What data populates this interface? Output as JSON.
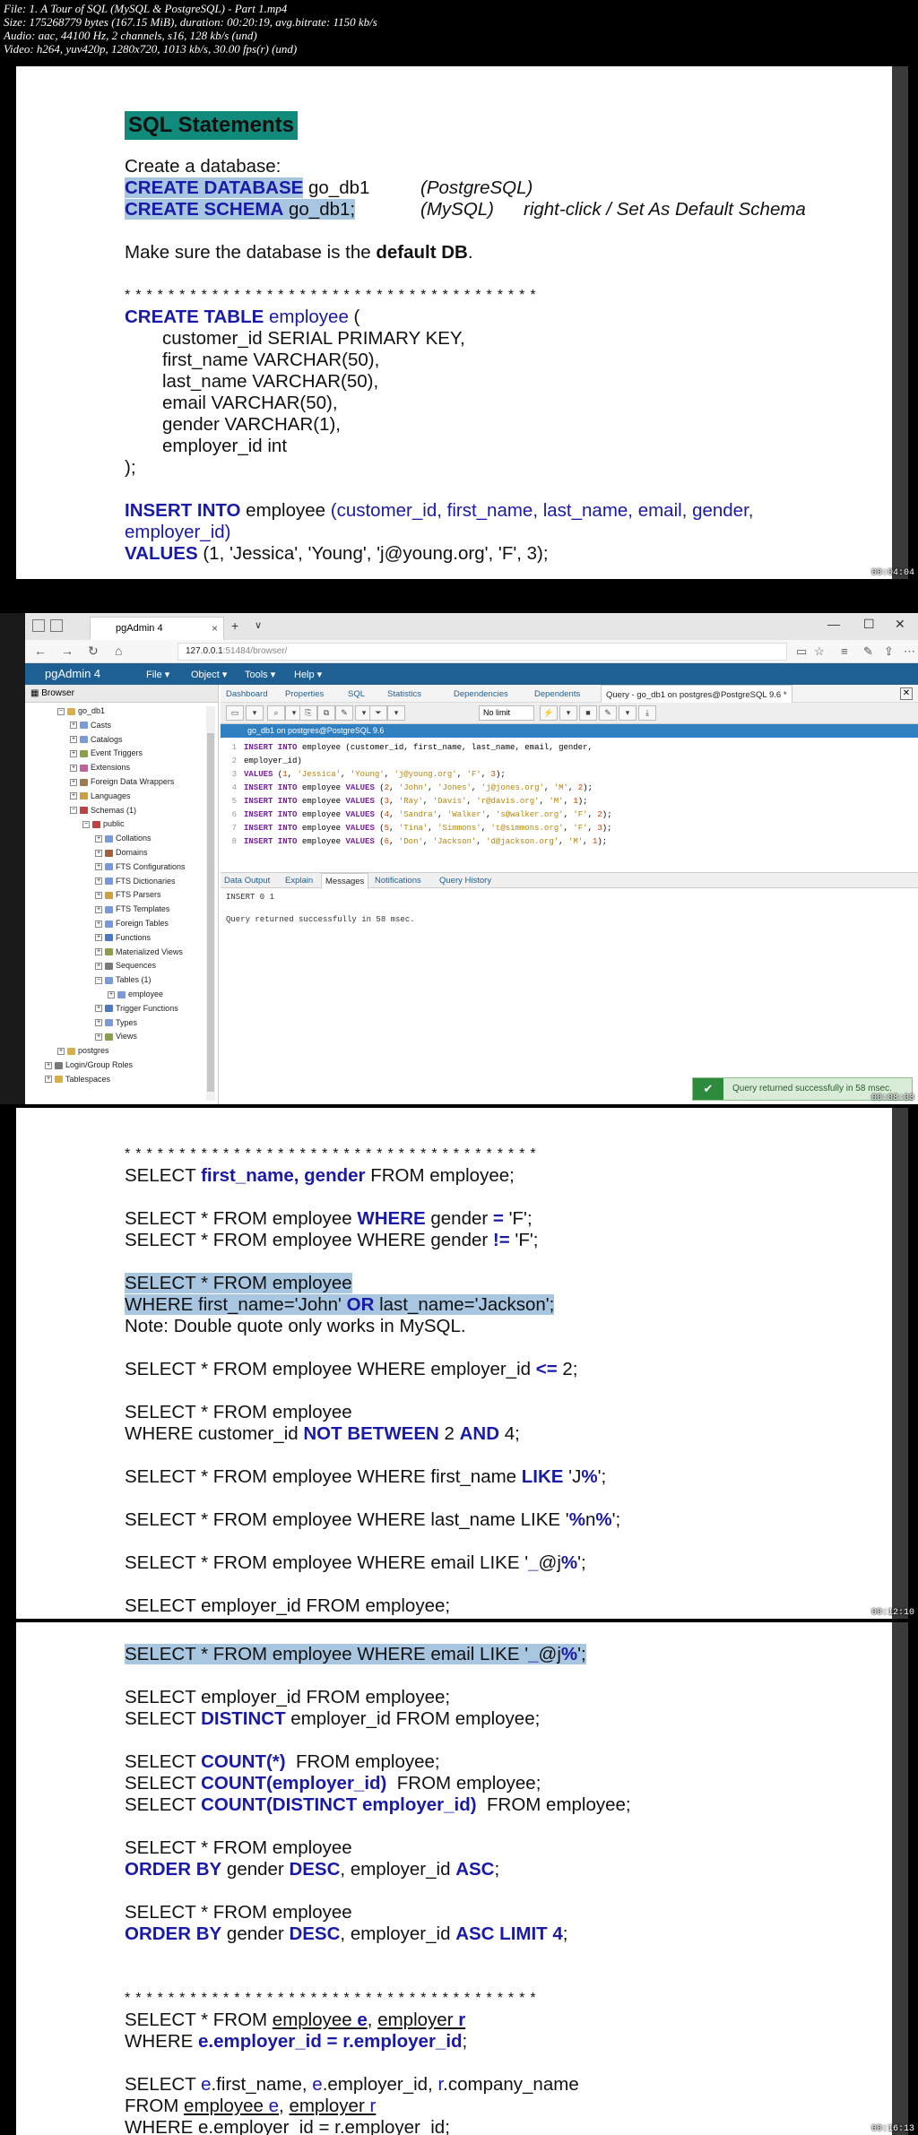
{
  "info": {
    "file": "File: 1. A Tour of SQL (MySQL & PostgreSQL) - Part 1.mp4",
    "size": "Size: 175268779 bytes (167.15 MiB), duration: 00:20:19, avg.bitrate: 1150 kb/s",
    "audio": "Audio: aac, 44100 Hz, 2 channels, s16, 128 kb/s (und)",
    "video": "Video: h264, yuv420p, 1280x720, 1013 kb/s, 30.00 fps(r) (und)"
  },
  "panel1": {
    "title": "SQL Statements",
    "create_db": "Create a database:",
    "create_database_kw": "CREATE DATABASE",
    "create_database_name": " go_db1",
    "postgres_note": "(PostgreSQL)",
    "create_schema_kw": "CREATE SCHEMA",
    "create_schema_name": " go_db1;",
    "mysql_note": "(MySQL)",
    "mysql_hint": "right-click / Set As Default Schema",
    "default_db_pre": "Make sure the database is the ",
    "default_db_bold": "default DB",
    "default_db_post": ".",
    "stars": "**************************************",
    "create_table_kw": "CREATE TABLE",
    "create_table_name": " employee",
    "create_table_paren": " (",
    "col1": "customer_id SERIAL PRIMARY KEY,",
    "col2": "first_name VARCHAR(50),",
    "col3": "last_name VARCHAR(50),",
    "col4": "email VARCHAR(50),",
    "col5": "gender VARCHAR(1),",
    "col6": "employer_id int",
    "close": ");",
    "insert_kw": "INSERT INTO",
    "insert_table": " employee ",
    "insert_cols": "(customer_id, first_name, last_name, email, gender,",
    "insert_cols2": "employer_id)",
    "values_kw": "VALUES",
    "values_data": " (1, 'Jessica', 'Young', 'j@young.org', 'F', 3);",
    "stamp": "00:04:04"
  },
  "pgadmin": {
    "tab_title": "pgAdmin 4",
    "tab_close": "×",
    "new_tab": "+",
    "tab_chevron": "∨",
    "win_min": "—",
    "win_max": "☐",
    "win_close": "✕",
    "nav_back": "←",
    "nav_forward": "→",
    "nav_refresh": "↻",
    "nav_home": "⌂",
    "url_host": "127.0.0.1",
    "url_path": ":51484/browser/",
    "brand": "pgAdmin 4",
    "menu": [
      "File ▾",
      "Object ▾",
      "Tools ▾",
      "Help ▾"
    ],
    "browser_label": "Browser",
    "tree": [
      {
        "label": "go_db1",
        "depth": 0,
        "sign": "−",
        "color": "#d8b04a"
      },
      {
        "label": "Casts",
        "depth": 1,
        "sign": "+",
        "color": "#7a9ad8"
      },
      {
        "label": "Catalogs",
        "depth": 1,
        "sign": "+",
        "color": "#7a9ad8"
      },
      {
        "label": "Event Triggers",
        "depth": 1,
        "sign": "+",
        "color": "#8aa04a"
      },
      {
        "label": "Extensions",
        "depth": 1,
        "sign": "+",
        "color": "#c060a0"
      },
      {
        "label": "Foreign Data Wrappers",
        "depth": 1,
        "sign": "+",
        "color": "#a07a4a"
      },
      {
        "label": "Languages",
        "depth": 1,
        "sign": "+",
        "color": "#d0a040"
      },
      {
        "label": "Schemas (1)",
        "depth": 1,
        "sign": "−",
        "color": "#c04040"
      },
      {
        "label": "public",
        "depth": 2,
        "sign": "−",
        "color": "#c04040"
      },
      {
        "label": "Collations",
        "depth": 3,
        "sign": "+",
        "color": "#7a9ad8"
      },
      {
        "label": "Domains",
        "depth": 3,
        "sign": "+",
        "color": "#a06040"
      },
      {
        "label": "FTS Configurations",
        "depth": 3,
        "sign": "+",
        "color": "#7a9ad8"
      },
      {
        "label": "FTS Dictionaries",
        "depth": 3,
        "sign": "+",
        "color": "#7a9ad8"
      },
      {
        "label": "FTS Parsers",
        "depth": 3,
        "sign": "+",
        "color": "#d0a040"
      },
      {
        "label": "FTS Templates",
        "depth": 3,
        "sign": "+",
        "color": "#7a9ad8"
      },
      {
        "label": "Foreign Tables",
        "depth": 3,
        "sign": "+",
        "color": "#7a9ad8"
      },
      {
        "label": "Functions",
        "depth": 3,
        "sign": "+",
        "color": "#4a7ac0"
      },
      {
        "label": "Materialized Views",
        "depth": 3,
        "sign": "+",
        "color": "#8aa04a"
      },
      {
        "label": "Sequences",
        "depth": 3,
        "sign": "+",
        "color": "#7a7a7a"
      },
      {
        "label": "Tables (1)",
        "depth": 3,
        "sign": "−",
        "color": "#7a9ad8"
      },
      {
        "label": "employee",
        "depth": 4,
        "sign": "+",
        "color": "#7a9ad8"
      },
      {
        "label": "Trigger Functions",
        "depth": 3,
        "sign": "+",
        "color": "#4a7ac0"
      },
      {
        "label": "Types",
        "depth": 3,
        "sign": "+",
        "color": "#7a9ad8"
      },
      {
        "label": "Views",
        "depth": 3,
        "sign": "+",
        "color": "#8aa04a"
      },
      {
        "label": "postgres",
        "depth": 0,
        "sign": "+",
        "color": "#d8b04a"
      },
      {
        "label": "Login/Group Roles",
        "depth": -1,
        "sign": "+",
        "color": "#7a7a7a"
      },
      {
        "label": "Tablespaces",
        "depth": -1,
        "sign": "+",
        "color": "#d8b04a"
      }
    ],
    "panel_tabs": [
      "Dashboard",
      "Properties",
      "SQL",
      "Statistics",
      "Dependencies",
      "Dependents"
    ],
    "query_tab": "Query - go_db1 on postgres@PostgreSQL 9.6 *",
    "close_box": "✕",
    "limit": "No limit",
    "toolbar_icons": [
      "▭",
      "▾",
      "⌕",
      "▾",
      "⎘",
      "⧉",
      "✎",
      "▾",
      "⏷",
      "▾",
      "⚡",
      "▾",
      "■",
      "✎",
      "▾",
      "⤓"
    ],
    "connection": "go_db1 on postgres@PostgreSQL 9.6",
    "sql_lines": [
      "INSERT INTO employee (customer_id, first_name, last_name, email, gender,",
      "employer_id)",
      "VALUES (1, 'Jessica', 'Young', 'j@young.org', 'F', 3);",
      "INSERT INTO employee VALUES (2, 'John', 'Jones', 'j@jones.org', 'M', 2);",
      "INSERT INTO employee VALUES (3, 'Ray', 'Davis', 'r@davis.org', 'M', 1);",
      "INSERT INTO employee VALUES (4, 'Sandra', 'Walker', 's@walker.org', 'F', 2);",
      "INSERT INTO employee VALUES (5, 'Tina', 'Simmons', 't@simmons.org', 'F', 3);",
      "INSERT INTO employee VALUES (6, 'Don', 'Jackson', 'd@jackson.org', 'M', 1);"
    ],
    "result_tabs": [
      "Data Output",
      "Explain",
      "Messages",
      "Notifications",
      "Query History"
    ],
    "active_result_tab": "Messages",
    "msg1": "INSERT 0 1",
    "msg2": "Query returned successfully in 58 msec.",
    "toast": "Query returned successfully in 58 msec.",
    "toast_icon": "✔",
    "stamp": "00:08:03"
  },
  "panel3": {
    "stars": "**************************************",
    "stamp": "00:12:10"
  },
  "panel4": {
    "stars": "**************************************",
    "stamp": "00:16:13"
  }
}
